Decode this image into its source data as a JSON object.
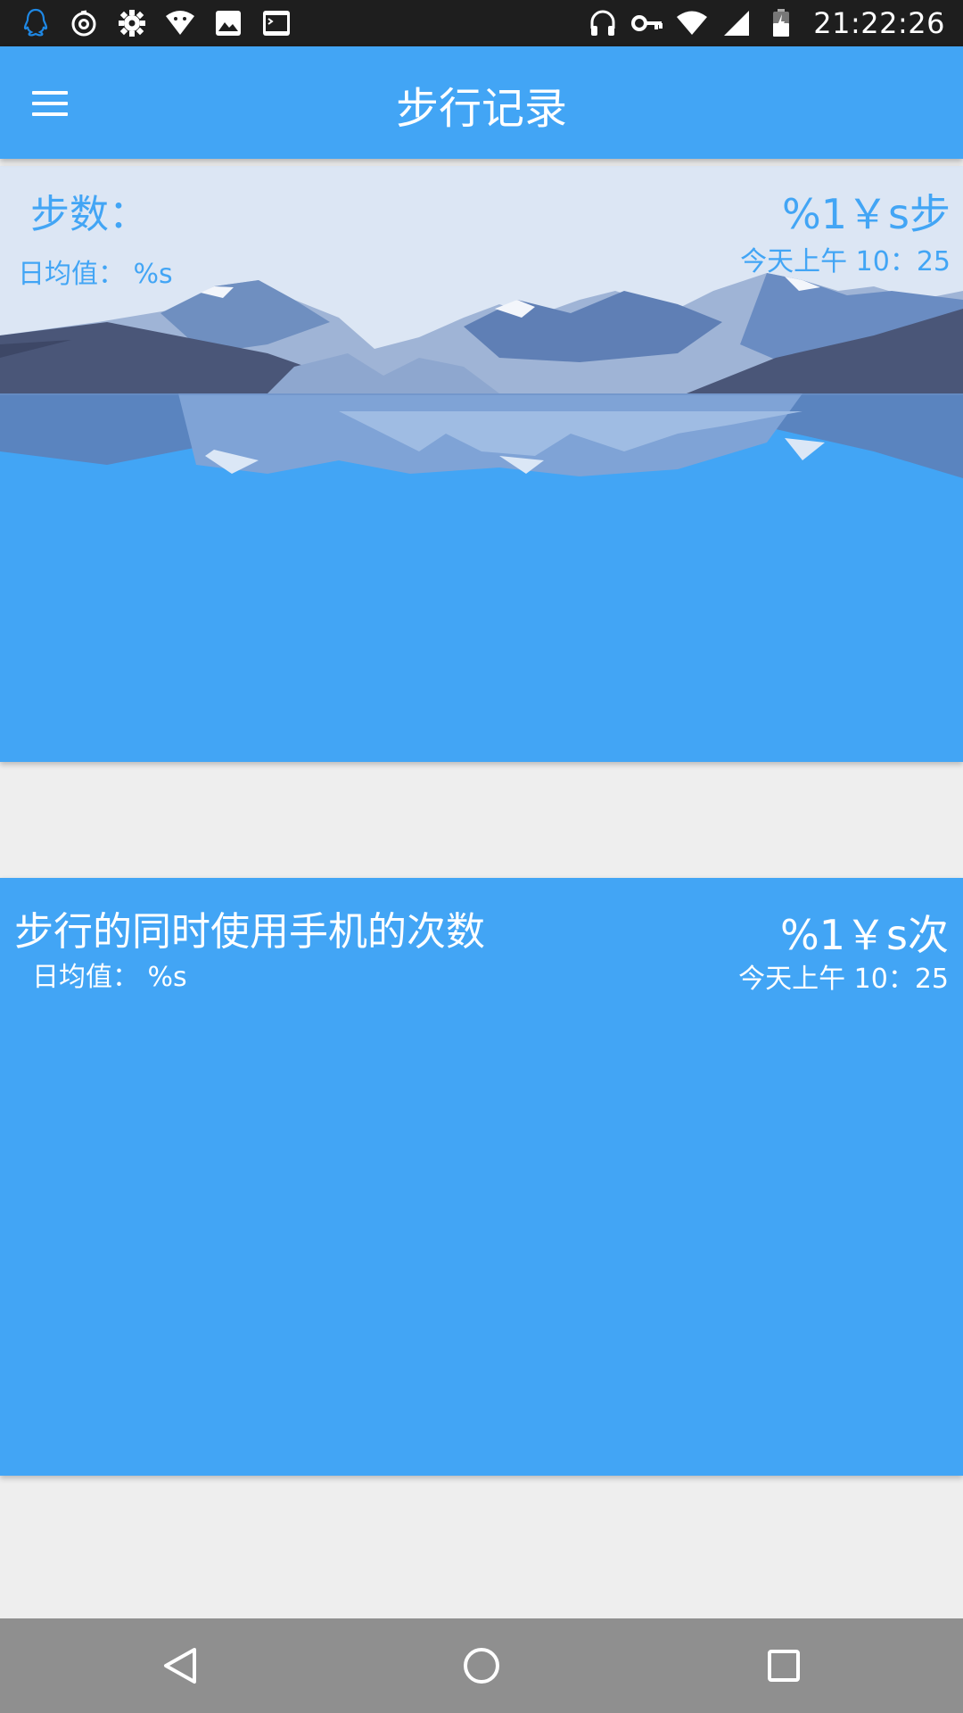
{
  "status_bar": {
    "time": "21:22:26",
    "left_icons": [
      "qq-icon",
      "netease-music-icon",
      "settings-gear-icon",
      "android-wifi-icon",
      "image-icon",
      "terminal-icon"
    ],
    "right_icons": [
      "headphones-icon",
      "vpn-key-icon",
      "wifi-signal-icon",
      "cell-signal-icon",
      "battery-charging-icon"
    ]
  },
  "app_bar": {
    "title": "步行记录",
    "menu_icon": "hamburger-menu-icon",
    "color": "#42a5f5"
  },
  "cards": [
    {
      "title": "步数：",
      "daily_avg": "日均值： %s",
      "value": "%1￥s步",
      "time": "今天上午 10：25"
    },
    {
      "title": "步行的同时使用手机的次数",
      "daily_avg": "日均值： %s",
      "value": "%1￥s次",
      "time": "今天上午 10：25"
    }
  ],
  "nav_bar": {
    "buttons": [
      "back-icon",
      "home-icon",
      "recents-icon"
    ]
  }
}
